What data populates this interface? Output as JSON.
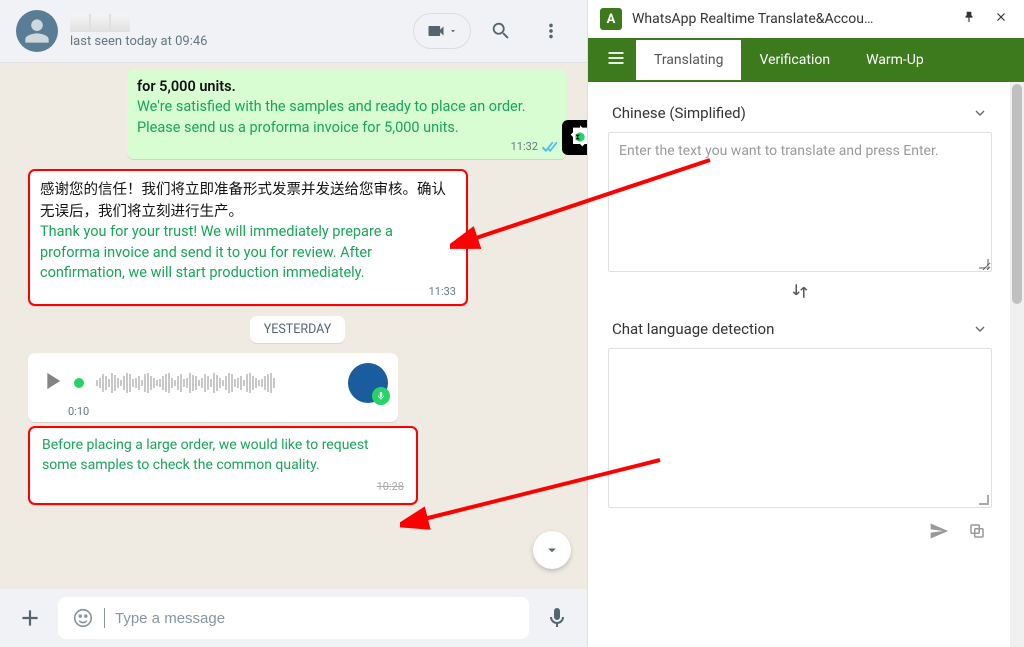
{
  "whatsapp": {
    "status": "last seen today at 09:46",
    "msg1_bold": "for 5,000 units.",
    "msg1_green": "We're satisfied with the samples and ready to place an order. Please send us a proforma invoice for 5,000 units.",
    "msg1_time": "11:32",
    "msg2_cn": "感谢您的信任！我们将立即准备形式发票并发送给您审核。确认无误后，我们将立刻进行生产。",
    "msg2_green": "Thank you for your trust! We will immediately prepare a proforma invoice and send it to you for review. After confirmation, we will start production immediately.",
    "msg2_time": "11:33",
    "divider": "YESTERDAY",
    "voice_duration": "0:10",
    "voice_trans": "Before placing a large order, we would like to request some samples to check the common quality.",
    "voice_trans_time": "10:28",
    "input_placeholder": "Type a message"
  },
  "ext": {
    "title": "WhatsApp Realtime Translate&Accou…",
    "tabs": {
      "t1": "Translating",
      "t2": "Verification",
      "t3": "Warm-Up"
    },
    "source_lang": "Chinese (Simplified)",
    "source_placeholder": "Enter the text you want to translate and press Enter.",
    "detect_label": "Chat language detection"
  }
}
